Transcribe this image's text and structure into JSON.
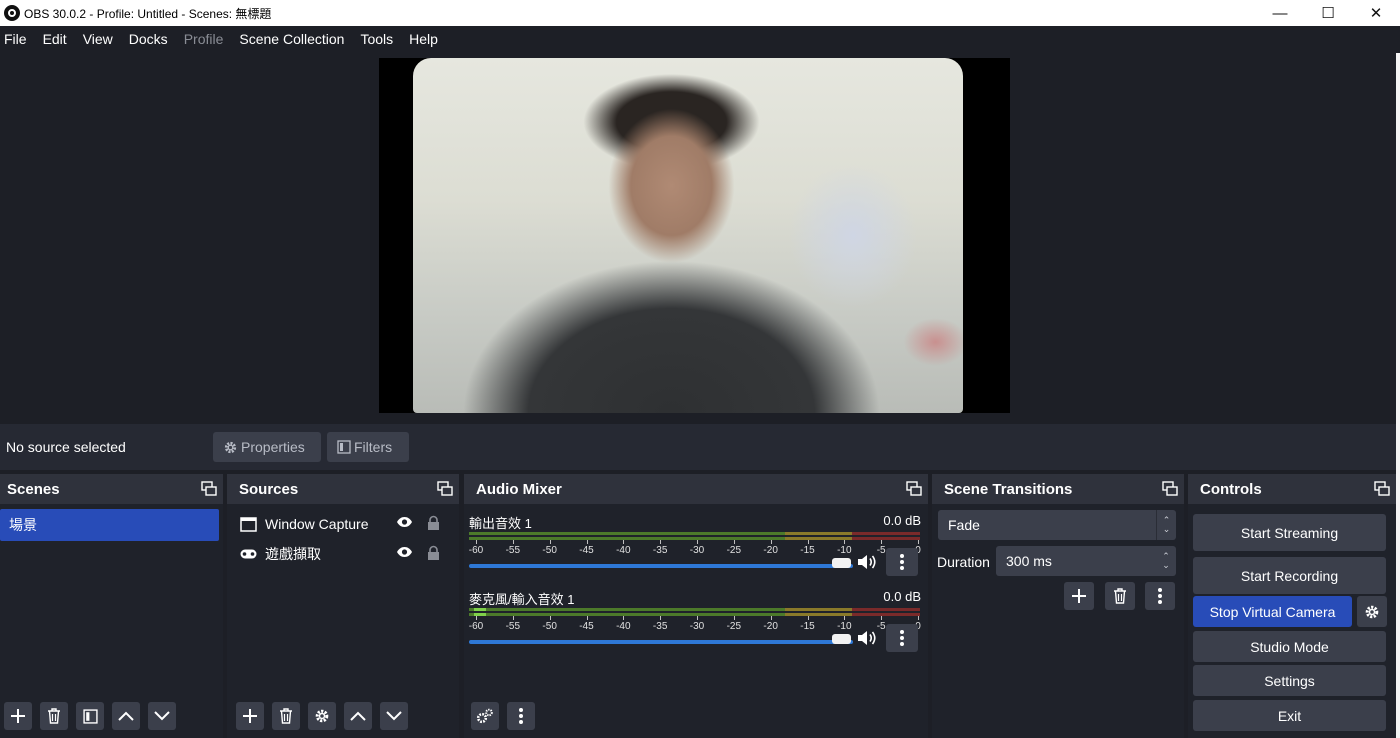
{
  "window": {
    "title": "OBS 30.0.2 - Profile: Untitled - Scenes: 無標題",
    "controls": [
      "minimize-icon",
      "maximize-icon",
      "close-icon"
    ],
    "minimize": "—",
    "maximize": "☐",
    "close": "✕"
  },
  "menu": {
    "file": "File",
    "edit": "Edit",
    "view": "View",
    "docks": "Docks",
    "profile": "Profile",
    "scene_collection": "Scene Collection",
    "tools": "Tools",
    "help": "Help"
  },
  "context_bar": {
    "status": "No source selected",
    "properties": "Properties",
    "filters": "Filters"
  },
  "scenes": {
    "title": "Scenes",
    "items": [
      "場景"
    ],
    "selected": "場景"
  },
  "sources": {
    "title": "Sources",
    "items": [
      {
        "label": "Window Capture",
        "icon": "window-icon",
        "visible": true,
        "locked": false
      },
      {
        "label": "遊戲擷取",
        "icon": "gamepad-icon",
        "visible": true,
        "locked": false
      }
    ]
  },
  "audio_mixer": {
    "title": "Audio Mixer",
    "tracks": [
      {
        "name": "輸出音效 1",
        "level": "0.0 dB"
      },
      {
        "name": "麥克風/輸入音效 1",
        "level": "0.0 dB"
      }
    ],
    "ticks": [
      "-60",
      "-55",
      "-50",
      "-45",
      "-40",
      "-35",
      "-30",
      "-25",
      "-20",
      "-15",
      "-10",
      "-5",
      "0"
    ]
  },
  "transitions": {
    "title": "Scene Transitions",
    "selected": "Fade",
    "duration_label": "Duration",
    "duration_value": "300 ms"
  },
  "controls": {
    "title": "Controls",
    "start_streaming": "Start Streaming",
    "start_recording": "Start Recording",
    "stop_virtual_camera": "Stop Virtual Camera",
    "studio_mode": "Studio Mode",
    "settings": "Settings",
    "exit": "Exit"
  },
  "colors": {
    "background": "#1d1f26",
    "dock": "#272a33",
    "button": "#3b3f4b",
    "accent": "#284cb8",
    "slider": "#2e78d6"
  }
}
